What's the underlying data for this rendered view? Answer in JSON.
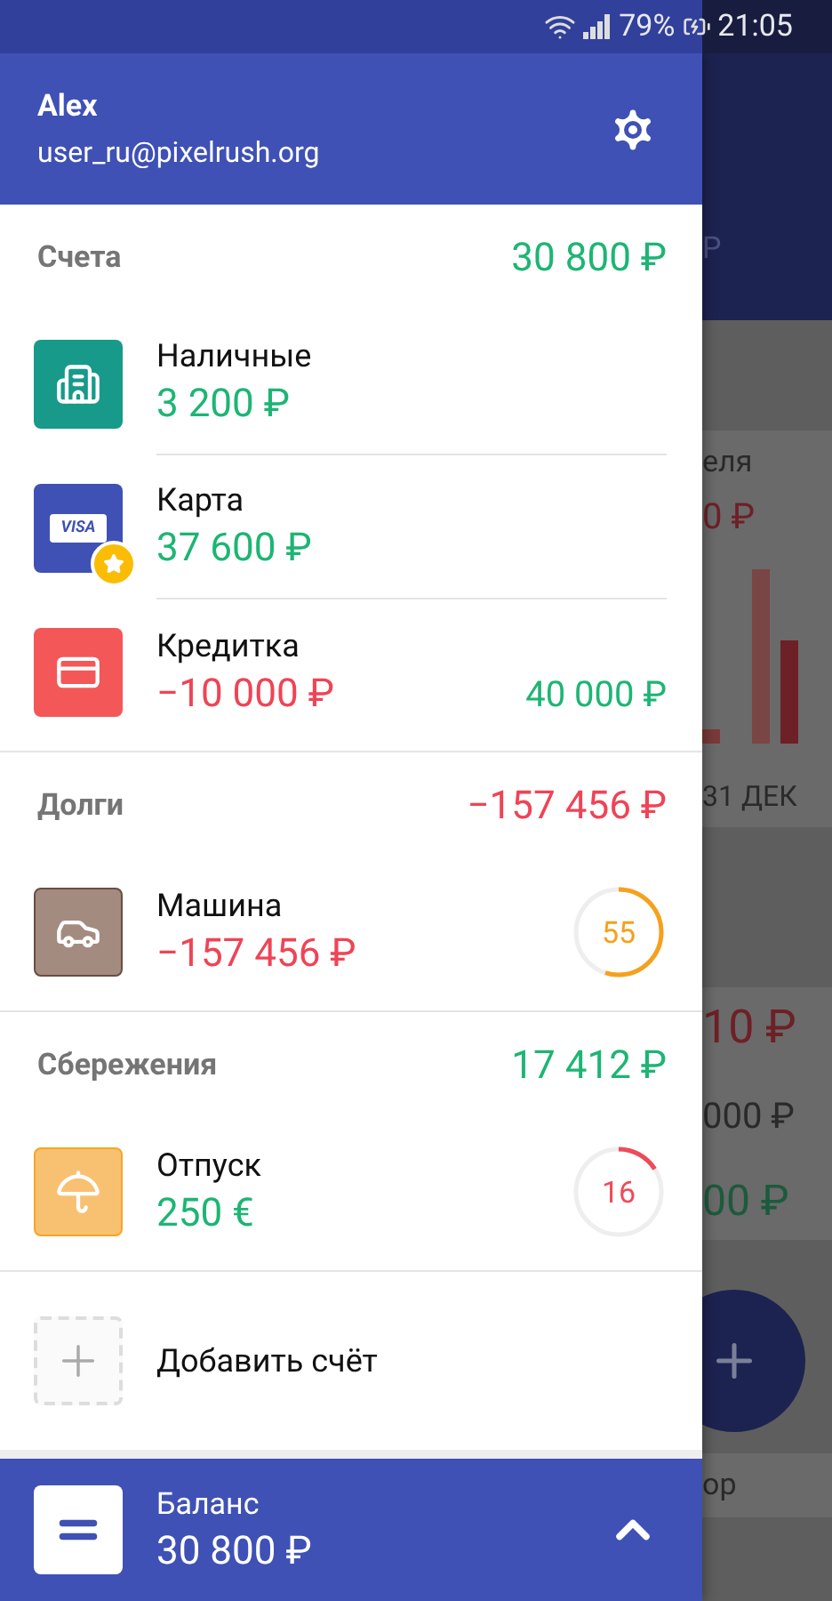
{
  "status_bar": {
    "battery": "79%",
    "time": "21:05"
  },
  "profile": {
    "name": "Alex",
    "email": "user_ru@pixelrush.org"
  },
  "groups": [
    {
      "title": "Счета",
      "total": "30 800 ₽",
      "negative": false,
      "accounts": [
        {
          "name": "Наличные",
          "amount": "3 200 ₽",
          "negative": false,
          "kind": "buildings",
          "favorite": false
        },
        {
          "name": "Карта",
          "amount": "37 600 ₽",
          "negative": false,
          "kind": "visa",
          "card_label": "VISA",
          "favorite": true
        },
        {
          "name": "Кредитка",
          "amount": "−10 000 ₽",
          "negative": true,
          "kind": "card",
          "favorite": false,
          "limit": "40 000 ₽"
        }
      ]
    },
    {
      "title": "Долги",
      "total": "−157 456 ₽",
      "negative": true,
      "accounts": [
        {
          "name": "Машина",
          "amount": "−157 456 ₽",
          "negative": true,
          "kind": "car",
          "favorite": false,
          "progress": {
            "label": "55",
            "color": "#f5a11c"
          }
        }
      ]
    },
    {
      "title": "Сбережения",
      "total": "17 412 ₽",
      "negative": false,
      "accounts": [
        {
          "name": "Отпуск",
          "amount": "250 €",
          "negative": false,
          "kind": "umbrella",
          "favorite": false,
          "progress": {
            "label": "16",
            "color": "#ef4a5a"
          }
        }
      ]
    }
  ],
  "add_account": {
    "label": "Добавить счёт"
  },
  "balance": {
    "label": "Баланс",
    "amount": "30 800 ₽"
  },
  "background": {
    "tab": "Р",
    "texts": [
      {
        "text": "еля"
      },
      {
        "text": "0 ₽"
      },
      {
        "text": "31 ДЕК"
      },
      {
        "text": "10 ₽"
      },
      {
        "text": "000 ₽"
      },
      {
        "text": "00 ₽"
      },
      {
        "text": "ор"
      }
    ]
  }
}
